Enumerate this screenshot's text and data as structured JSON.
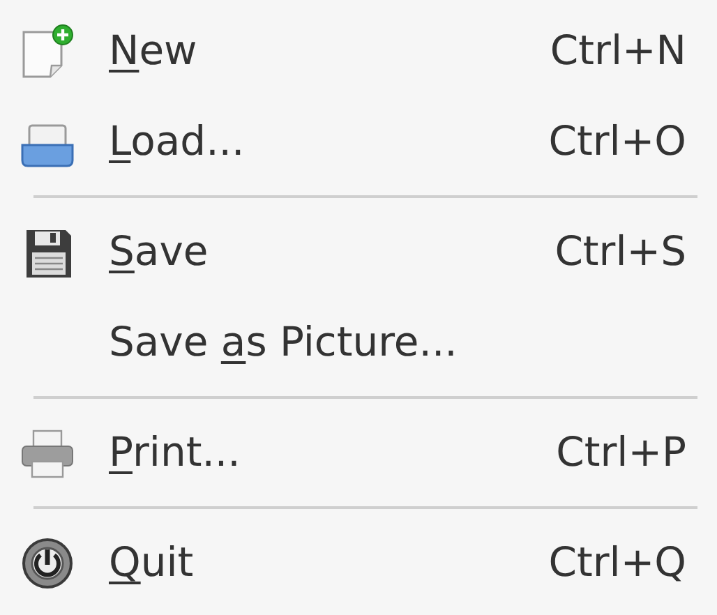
{
  "menu": {
    "entries": [
      {
        "kind": "new",
        "label": {
          "key": "N",
          "after": "ew"
        },
        "shortcut": "Ctrl+N"
      },
      {
        "kind": "load",
        "label": {
          "key": "L",
          "after": "oad..."
        },
        "shortcut": "Ctrl+O"
      },
      {
        "kind": "separator"
      },
      {
        "kind": "save",
        "label": {
          "key": "S",
          "after": "ave"
        },
        "shortcut": "Ctrl+S"
      },
      {
        "kind": "plain",
        "label": {
          "before": "Save ",
          "key": "a",
          "after": "s Picture..."
        }
      },
      {
        "kind": "separator"
      },
      {
        "kind": "print",
        "label": {
          "key": "P",
          "after": "rint..."
        },
        "shortcut": "Ctrl+P"
      },
      {
        "kind": "separator"
      },
      {
        "kind": "quit",
        "label": {
          "key": "Q",
          "after": "uit"
        },
        "shortcut": "Ctrl+Q"
      }
    ]
  }
}
